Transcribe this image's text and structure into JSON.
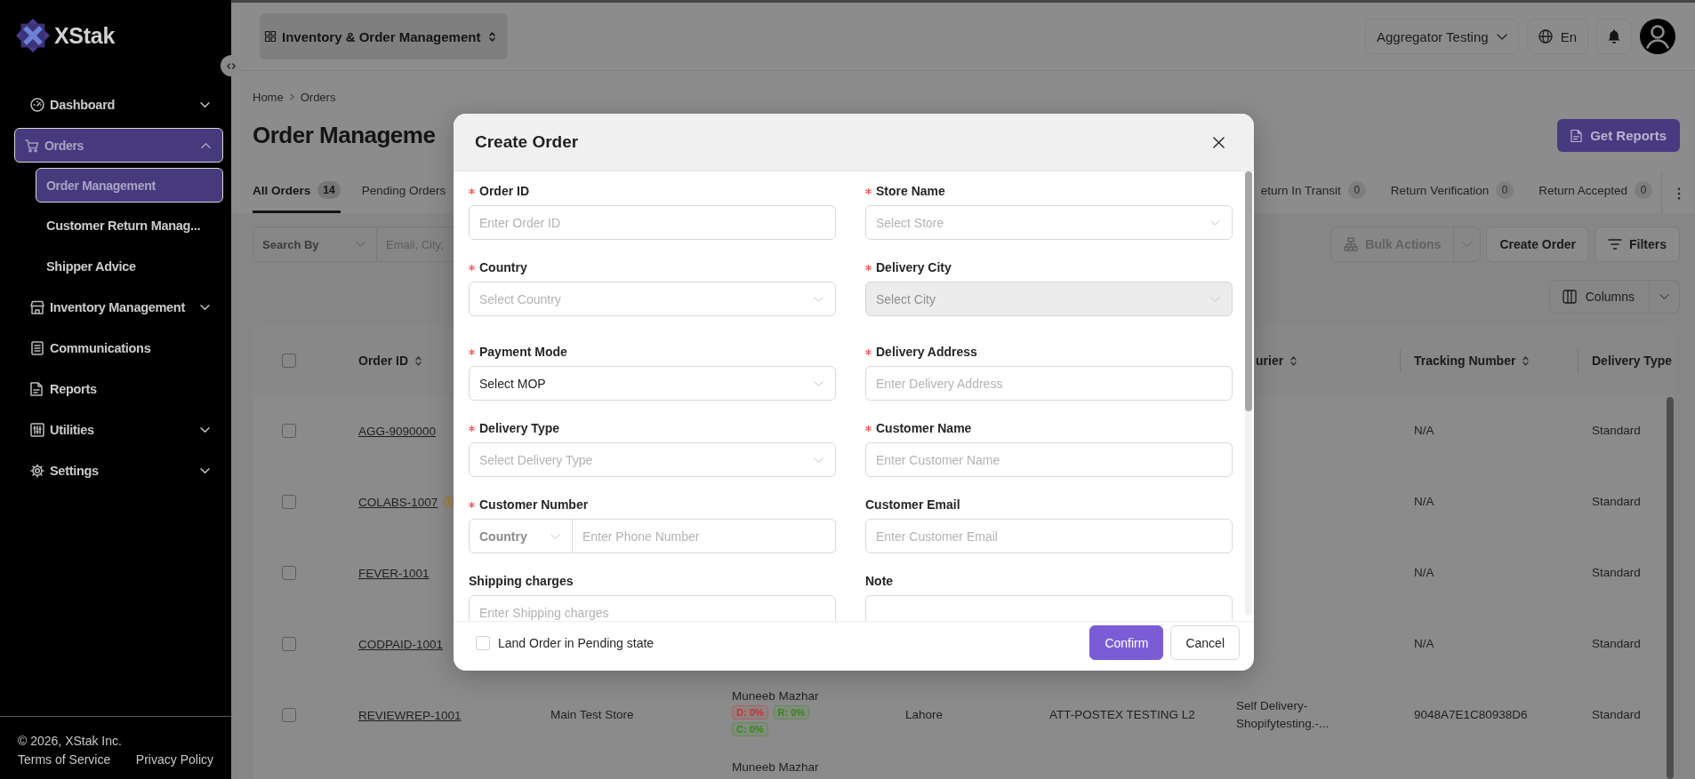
{
  "sidebar": {
    "logo": "XStak",
    "items": [
      {
        "label": "Dashboard",
        "selected": false,
        "expanded": false
      },
      {
        "label": "Orders",
        "selected": true,
        "expanded": true,
        "children": [
          {
            "label": "Order Management",
            "selected": true
          },
          {
            "label": "Customer Return Manag...",
            "selected": false
          },
          {
            "label": "Shipper Advice",
            "selected": false
          }
        ]
      },
      {
        "label": "Inventory Management",
        "selected": false,
        "expanded": false
      },
      {
        "label": "Communications",
        "selected": false
      },
      {
        "label": "Reports",
        "selected": false
      },
      {
        "label": "Utilities",
        "selected": false,
        "expanded": false
      },
      {
        "label": "Settings",
        "selected": false,
        "expanded": false
      }
    ],
    "footer": {
      "copyright": "© 2026, XStak Inc.",
      "links": [
        "Terms of Service",
        "Privacy Policy"
      ]
    }
  },
  "top_bar": {
    "app_switcher": "Inventory & Order Management",
    "account": "Aggregator Testing",
    "language": "En"
  },
  "page": {
    "breadcrumb": [
      "Home",
      "Orders"
    ],
    "title": "Order Manageme",
    "report_button": "Get Reports",
    "tabs": [
      {
        "label": "All Orders",
        "count": "14",
        "selected": true
      },
      {
        "label": "Pending Orders",
        "selected": false
      },
      {
        "label": "eturn In Transit",
        "count": "0",
        "selected": false
      },
      {
        "label": "Return Verification",
        "count": "0",
        "selected": false
      },
      {
        "label": "Return Accepted",
        "count": "0",
        "selected": false
      }
    ],
    "search": {
      "by": "Search By",
      "placeholder": "Email, City,"
    },
    "actions": [
      {
        "kind": "split",
        "label": "Bulk Actions",
        "disabled": true
      },
      {
        "kind": "plain",
        "label": "Create Order",
        "disabled": false
      },
      {
        "kind": "filter",
        "label": "Filters",
        "disabled": false
      }
    ],
    "columns_button": "Columns",
    "table": {
      "all_checked": false,
      "columns": {
        "order_id": {
          "label": "Order ID",
          "sortable": true
        },
        "column_7": {
          "label": "urier",
          "sortable": true
        },
        "tracking_number": {
          "label": "Tracking Number",
          "sortable": true
        },
        "delivery_type": {
          "label": "Delivery Type",
          "sortable": false
        }
      },
      "rows": [
        {
          "checked": false,
          "alert": false,
          "order_id": "AGG-9090000",
          "tracking_number": "N/A",
          "delivery_type": "Standard"
        },
        {
          "checked": false,
          "alert": true,
          "order_id": "COLABS-1007",
          "tracking_number": "N/A",
          "delivery_type": "Standard"
        },
        {
          "checked": false,
          "alert": false,
          "order_id": "FEVER-1001",
          "tracking_number": "N/A",
          "delivery_type": "Standard"
        },
        {
          "checked": false,
          "alert": false,
          "order_id": "CODPAID-1001",
          "tracking_number": "N/A",
          "delivery_type": "Standard"
        },
        {
          "checked": false,
          "alert": false,
          "order_id": "REVIEWREP-1001",
          "column_3": "Main Test Store",
          "column_4": {
            "name": "Muneeb Mazhar",
            "badges": [
              {
                "label": "D: 0%",
                "color": "#c8302e"
              },
              {
                "label": "R: 0%",
                "color": "#2f8a12"
              },
              {
                "label": "C: 0%",
                "color": "#2f8a12"
              }
            ]
          },
          "column_5": "Lahore",
          "column_6": "ATT-POSTEX TESTING L2",
          "column_7": "Self Delivery-\nShopifytesting.-...",
          "tracking_number": "9048A7E1C80938D6",
          "delivery_type": "Standard"
        },
        {
          "column_4": {
            "name": "Muneeb Mazhar"
          }
        }
      ]
    }
  },
  "modal": {
    "title": "Create Order",
    "fields": [
      {
        "kind": "input",
        "label": "Order ID",
        "required": true,
        "disabled": false,
        "placeholder": "Enter Order ID"
      },
      {
        "kind": "select",
        "label": "Store Name",
        "required": true,
        "disabled": false,
        "placeholder": "Select Store"
      },
      {
        "kind": "select",
        "label": "Country",
        "required": true,
        "disabled": false,
        "placeholder": "Select Country"
      },
      {
        "kind": "select",
        "label": "Delivery City",
        "required": true,
        "disabled": true,
        "placeholder": "Select City"
      },
      {
        "kind": "select",
        "label": "Payment Mode",
        "required": true,
        "disabled": false,
        "value": "Select MOP"
      },
      {
        "kind": "input",
        "label": "Delivery Address",
        "required": true,
        "disabled": false,
        "placeholder": "Enter Delivery Address"
      },
      {
        "kind": "select",
        "label": "Delivery Type",
        "required": true,
        "disabled": false,
        "placeholder": "Select Delivery Type"
      },
      {
        "kind": "input",
        "label": "Customer Name",
        "required": true,
        "disabled": false,
        "placeholder": "Enter Customer Name"
      },
      {
        "kind": "phone",
        "label": "Customer Number",
        "required": true,
        "disabled": false,
        "country": "Country",
        "placeholder": "Enter Phone Number"
      },
      {
        "kind": "input",
        "label": "Customer Email",
        "required": false,
        "disabled": false,
        "placeholder": "Enter Customer Email"
      },
      {
        "kind": "input",
        "label": "Shipping charges",
        "required": false,
        "disabled": false,
        "placeholder": "Enter Shipping charges"
      },
      {
        "kind": "textarea",
        "label": "Note",
        "required": false,
        "disabled": false
      }
    ],
    "pending_option": {
      "label": "Land Order in Pending state",
      "checked": false
    },
    "buttons": [
      {
        "label": "Confirm",
        "primary": true
      },
      {
        "label": "Cancel",
        "primary": false
      }
    ]
  }
}
